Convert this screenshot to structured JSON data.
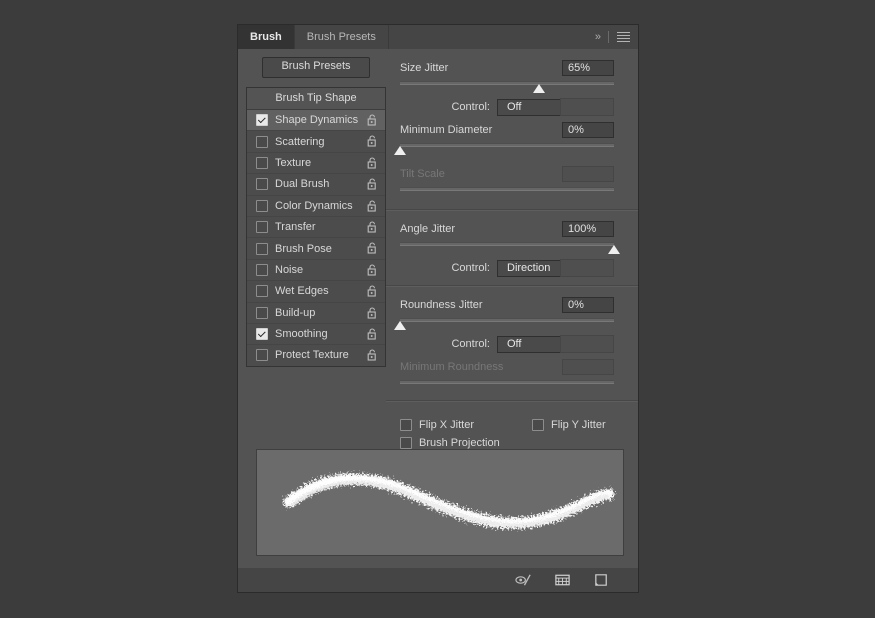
{
  "panel": {
    "tabs": [
      {
        "label": "Brush",
        "active": true
      },
      {
        "label": "Brush Presets",
        "active": false
      }
    ],
    "collapse_icon": "chevron-double-right-icon",
    "menu_icon": "panel-menu-icon"
  },
  "sidebar": {
    "presets_button": "Brush Presets",
    "list_header": "Brush Tip Shape",
    "items": [
      {
        "label": "Shape Dynamics",
        "checked": true,
        "selected": true,
        "locked": false
      },
      {
        "label": "Scattering",
        "checked": false,
        "selected": false,
        "locked": false
      },
      {
        "label": "Texture",
        "checked": false,
        "selected": false,
        "locked": false
      },
      {
        "label": "Dual Brush",
        "checked": false,
        "selected": false,
        "locked": false
      },
      {
        "label": "Color Dynamics",
        "checked": false,
        "selected": false,
        "locked": false
      },
      {
        "label": "Transfer",
        "checked": false,
        "selected": false,
        "locked": false
      },
      {
        "label": "Brush Pose",
        "checked": false,
        "selected": false,
        "locked": false
      },
      {
        "label": "Noise",
        "checked": false,
        "selected": false,
        "locked": false
      },
      {
        "label": "Wet Edges",
        "checked": false,
        "selected": false,
        "locked": false
      },
      {
        "label": "Build-up",
        "checked": false,
        "selected": false,
        "locked": false
      },
      {
        "label": "Smoothing",
        "checked": true,
        "selected": false,
        "locked": false
      },
      {
        "label": "Protect Texture",
        "checked": false,
        "selected": false,
        "locked": false
      }
    ]
  },
  "shape_dynamics": {
    "size_jitter": {
      "label": "Size Jitter",
      "value": "65%",
      "slider_percent": 65,
      "control_label": "Control:",
      "control_value": "Off",
      "control_extra": ""
    },
    "minimum_diameter": {
      "label": "Minimum Diameter",
      "value": "0%",
      "slider_percent": 0
    },
    "tilt_scale": {
      "label": "Tilt Scale",
      "value": "",
      "slider_percent": 0,
      "disabled": true
    },
    "angle_jitter": {
      "label": "Angle Jitter",
      "value": "100%",
      "slider_percent": 100,
      "control_label": "Control:",
      "control_value": "Direction",
      "control_extra": ""
    },
    "roundness_jitter": {
      "label": "Roundness Jitter",
      "value": "0%",
      "slider_percent": 0,
      "control_label": "Control:",
      "control_value": "Off",
      "control_extra": ""
    },
    "minimum_roundness": {
      "label": "Minimum Roundness",
      "value": "",
      "slider_percent": 0,
      "disabled": true
    },
    "flip_x_jitter": {
      "label": "Flip X Jitter",
      "checked": false
    },
    "flip_y_jitter": {
      "label": "Flip Y Jitter",
      "checked": false
    },
    "brush_projection": {
      "label": "Brush Projection",
      "checked": false
    }
  },
  "footer": {
    "icons": [
      {
        "name": "toggle-brush-settings-icon"
      },
      {
        "name": "new-brush-preset-grid-icon"
      },
      {
        "name": "create-new-brush-icon"
      }
    ]
  },
  "colors": {
    "panel_bg": "#535353",
    "header_bg": "#454545",
    "active_tab_bg": "#333333",
    "list_bg": "#4c4c4c",
    "selected_row": "#616161",
    "text": "#d8d8d8",
    "text_disabled": "#777777",
    "preview_bg": "#6b6b6b",
    "stroke": "#f0f0f0"
  }
}
